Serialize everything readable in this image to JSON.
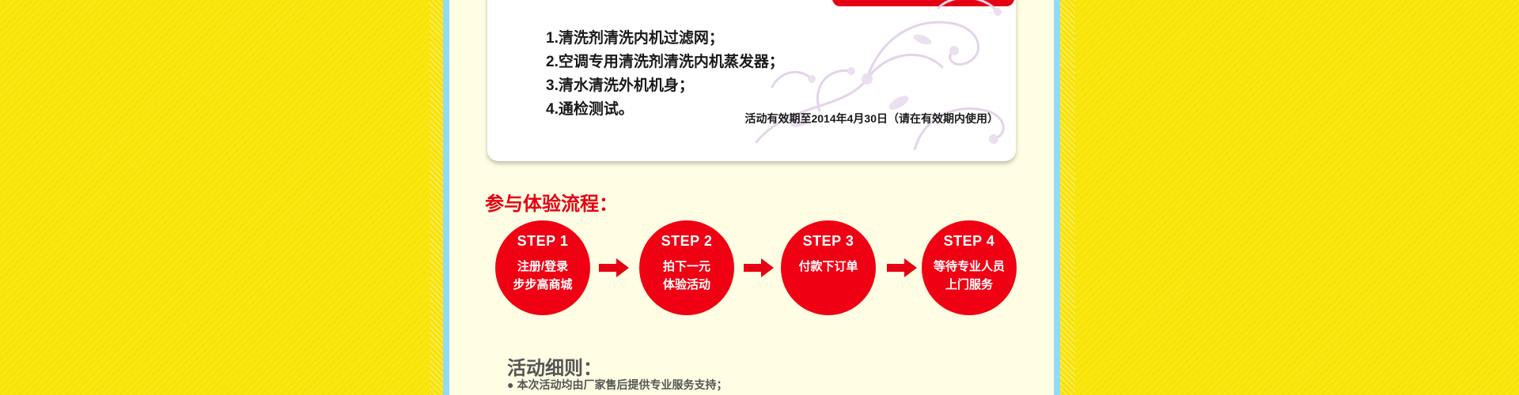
{
  "card": {
    "items": [
      "1.清洗剂清洗内机过滤网；",
      "2.空调专用清洗剂清洗内机蒸发器；",
      "3.清水清洗外机机身；",
      "4.通检测试。"
    ],
    "validity": "活动有效期至2014年4月30日（请在有效期内使用）"
  },
  "process": {
    "heading": "参与体验流程：",
    "steps": [
      {
        "title": "STEP 1",
        "desc": "注册/登录\n步步高商城"
      },
      {
        "title": "STEP 2",
        "desc": "拍下一元\n体验活动"
      },
      {
        "title": "STEP 3",
        "desc": "付款下订单"
      },
      {
        "title": "STEP 4",
        "desc": "等待专业人员\n上门服务"
      }
    ]
  },
  "rules": {
    "heading": "活动细则：",
    "bullet": "●",
    "items": [
      "本次活动均由厂家售后提供专业服务支持；"
    ]
  },
  "colors": {
    "background": "#f8e400",
    "accent_red": "#e50012",
    "rail_blue": "#93dbf5",
    "column_cream": "#fffde3",
    "text_dark": "#1a1a1a",
    "text_gray": "#555555"
  },
  "icons": {
    "arrow": "right-arrow-icon",
    "decoration": "floral-decoration"
  }
}
